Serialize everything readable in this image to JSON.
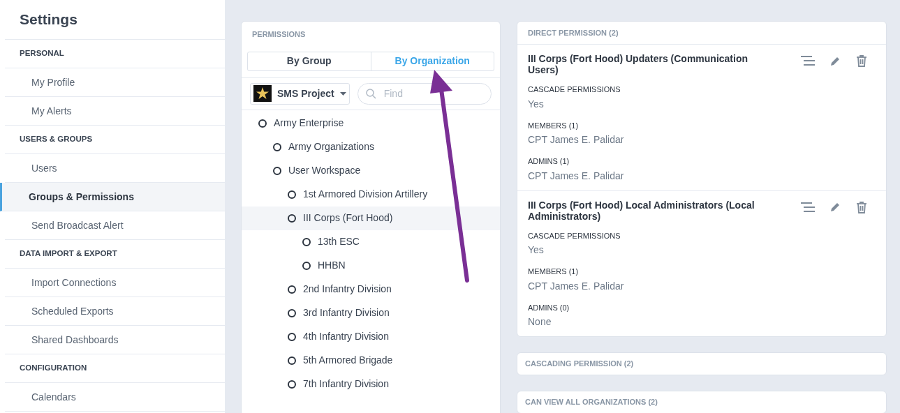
{
  "sidebar": {
    "title": "Settings",
    "sections": [
      {
        "heading": "PERSONAL",
        "items": [
          {
            "label": "My Profile",
            "selected": false
          },
          {
            "label": "My Alerts",
            "selected": false
          }
        ]
      },
      {
        "heading": "USERS & GROUPS",
        "items": [
          {
            "label": "Users",
            "selected": false
          },
          {
            "label": "Groups & Permissions",
            "selected": true
          },
          {
            "label": "Send Broadcast Alert",
            "selected": false
          }
        ]
      },
      {
        "heading": "DATA IMPORT & EXPORT",
        "items": [
          {
            "label": "Import Connections",
            "selected": false
          },
          {
            "label": "Scheduled Exports",
            "selected": false
          },
          {
            "label": "Shared Dashboards",
            "selected": false
          }
        ]
      },
      {
        "heading": "CONFIGURATION",
        "items": [
          {
            "label": "Calendars",
            "selected": false
          }
        ]
      }
    ]
  },
  "permissions": {
    "heading": "PERMISSIONS",
    "tabs": [
      {
        "label": "By Group",
        "selected": false
      },
      {
        "label": "By Organization",
        "selected": true
      }
    ],
    "project": {
      "label": "SMS Project"
    },
    "search": {
      "placeholder": "Find"
    },
    "tree": [
      {
        "label": "Army Enterprise",
        "selected": false,
        "children": [
          {
            "label": "Army Organizations",
            "selected": false
          },
          {
            "label": "User Workspace",
            "selected": false,
            "children": [
              {
                "label": "1st Armored Division Artillery",
                "selected": false
              },
              {
                "label": "III Corps (Fort Hood)",
                "selected": true,
                "children": [
                  {
                    "label": "13th ESC",
                    "selected": false
                  },
                  {
                    "label": "HHBN",
                    "selected": false
                  }
                ]
              },
              {
                "label": "2nd Infantry Division",
                "selected": false
              },
              {
                "label": "3rd Infantry Division",
                "selected": false
              },
              {
                "label": "4th Infantry Division",
                "selected": false
              },
              {
                "label": "5th Armored Brigade",
                "selected": false
              },
              {
                "label": "7th Infantry Division",
                "selected": false
              }
            ]
          }
        ]
      }
    ]
  },
  "direct": {
    "heading": "DIRECT PERMISSION (2)",
    "groups": [
      {
        "title": "III Corps (Fort Hood) Updaters (Communication Users)",
        "fields": [
          {
            "label": "CASCADE PERMISSIONS",
            "value": "Yes"
          },
          {
            "label": "MEMBERS (1)",
            "value": "CPT James E. Palidar"
          },
          {
            "label": "ADMINS (1)",
            "value": "CPT James E. Palidar"
          }
        ]
      },
      {
        "title": "III Corps (Fort Hood) Local Administrators (Local Administrators)",
        "fields": [
          {
            "label": "CASCADE PERMISSIONS",
            "value": "Yes"
          },
          {
            "label": "MEMBERS (1)",
            "value": "CPT James E. Palidar"
          },
          {
            "label": "ADMINS (0)",
            "value": "None"
          }
        ]
      }
    ]
  },
  "collapsed_sections": [
    {
      "heading": "CASCADING PERMISSION (2)"
    },
    {
      "heading": "CAN VIEW ALL ORGANIZATIONS (2)"
    }
  ]
}
